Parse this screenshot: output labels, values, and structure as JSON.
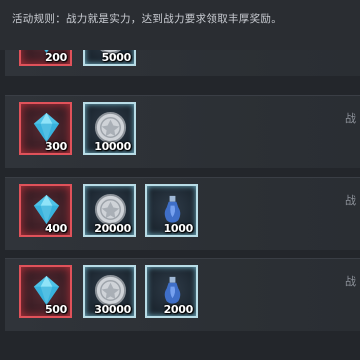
{
  "rules": {
    "text": "活动规则：战力就是实力，达到战力要求领取丰厚奖励。"
  },
  "rows": [
    {
      "side": "",
      "items": [
        {
          "type": "diamond",
          "qty": "200"
        },
        {
          "type": "coin",
          "qty": "5000"
        }
      ]
    },
    {
      "side": "战",
      "items": [
        {
          "type": "diamond",
          "qty": "300"
        },
        {
          "type": "coin",
          "qty": "10000"
        }
      ]
    },
    {
      "side": "战",
      "items": [
        {
          "type": "diamond",
          "qty": "400"
        },
        {
          "type": "coin",
          "qty": "20000"
        },
        {
          "type": "potion",
          "qty": "1000"
        }
      ]
    },
    {
      "side": "战",
      "items": [
        {
          "type": "diamond",
          "qty": "500"
        },
        {
          "type": "coin",
          "qty": "30000"
        },
        {
          "type": "potion",
          "qty": "2000"
        }
      ]
    }
  ],
  "colors": {
    "accent_red": "#e0525a",
    "accent_cyan": "#b8dce6",
    "background": "#23262b"
  },
  "icons": {
    "diamond": "diamond-icon",
    "coin": "silver-coin-icon",
    "potion": "blue-potion-icon"
  }
}
